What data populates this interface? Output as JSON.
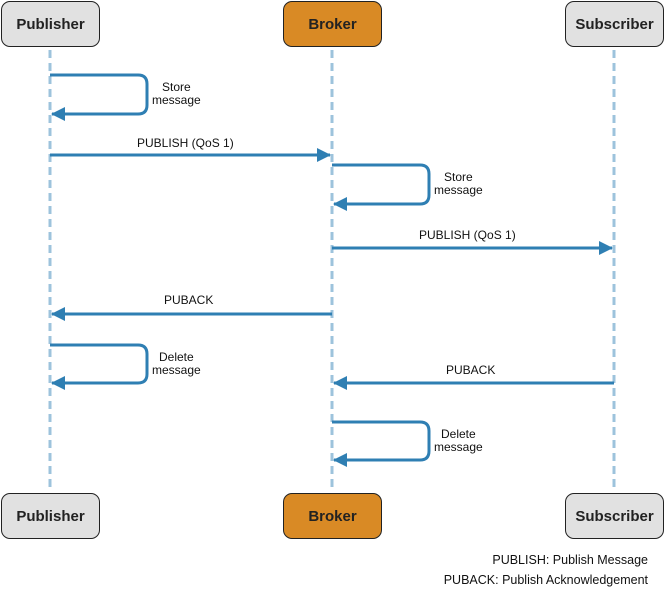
{
  "colors": {
    "arrow": "#2f7fb3",
    "lifeline": "#9dc3dc",
    "actor_gray": "#e1e1e1",
    "actor_broker": "#d98a25",
    "border": "#222222"
  },
  "actors": {
    "publisher": "Publisher",
    "broker": "Broker",
    "subscriber": "Subscriber"
  },
  "messages": {
    "m1": "Store\nmessage",
    "m2": "PUBLISH (QoS 1)",
    "m3": "Store\nmessage",
    "m4": "PUBLISH (QoS 1)",
    "m5": "PUBACK",
    "m6": "Delete\nmessage",
    "m7": "PUBACK",
    "m8": "Delete\nmessage"
  },
  "self_labels": {
    "m1_line1": "Store",
    "m1_line2": "message",
    "m3_line1": "Store",
    "m3_line2": "message",
    "m6_line1": "Delete",
    "m6_line2": "message",
    "m8_line1": "Delete",
    "m8_line2": "message"
  },
  "legend": {
    "line1": "PUBLISH: Publish Message",
    "line2": "PUBACK: Publish Acknowledgement"
  }
}
